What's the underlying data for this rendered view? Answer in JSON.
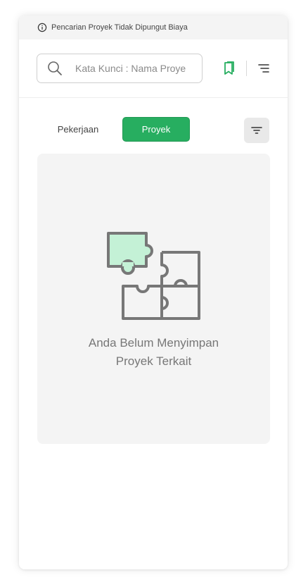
{
  "notice": {
    "text": "Pencarian Proyek Tidak Dipungut Biaya",
    "icon": "info-icon"
  },
  "search": {
    "placeholder": "Kata Kunci : Nama Proyek",
    "value": "",
    "icon": "search-icon"
  },
  "header_icons": {
    "bookmark": "bookmark-icon",
    "menu": "menu-icon"
  },
  "tabs": [
    {
      "label": "Pekerjaan",
      "active": false
    },
    {
      "label": "Proyek",
      "active": true
    }
  ],
  "filter": {
    "icon": "filter-icon"
  },
  "empty_state": {
    "icon": "puzzle-icon",
    "line1": "Anda Belum Menyimpan",
    "line2": "Proyek Terkait"
  },
  "colors": {
    "accent": "#27ae60",
    "puzzle_highlight": "#c4f1d6",
    "puzzle_stroke": "#777777",
    "card_bg": "#f4f4f4"
  }
}
